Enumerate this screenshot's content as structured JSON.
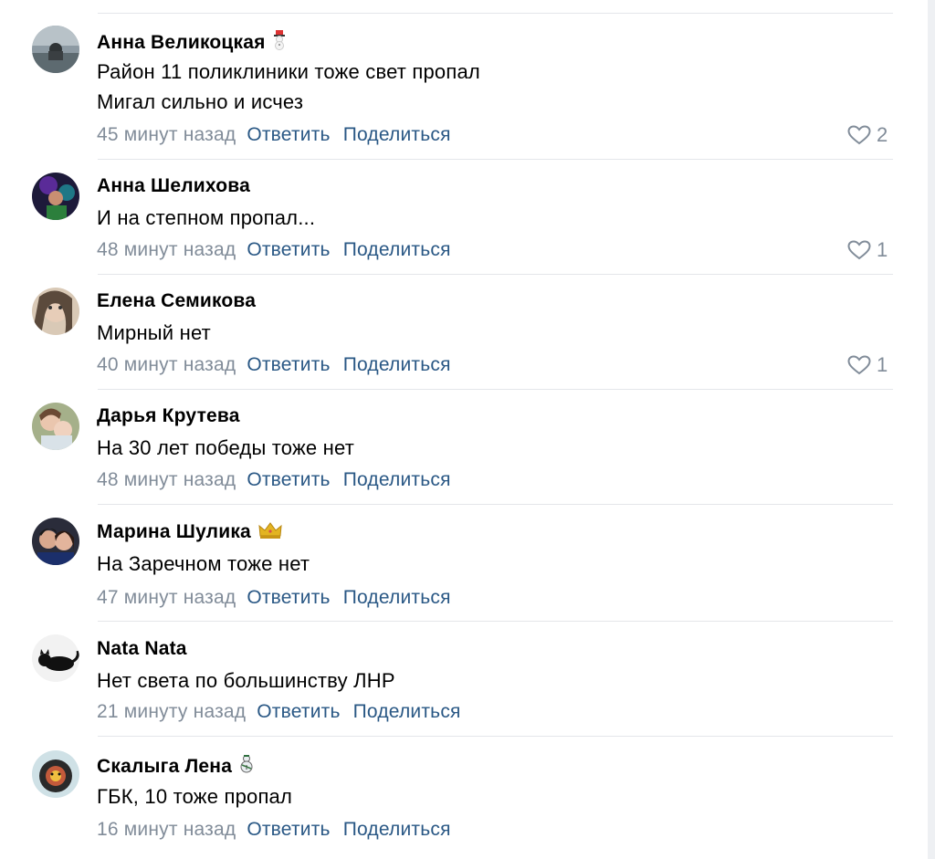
{
  "comments": [
    {
      "author": "Анна Великоцкая",
      "author_emoji": "snowman-icon",
      "lines": [
        "Район 11 поликлиники тоже свет пропал",
        "Мигал сильно и исчез"
      ],
      "time": "45 минут назад",
      "reply": "Ответить",
      "share": "Поделиться",
      "likes": "2"
    },
    {
      "author": "Анна Шелихова",
      "lines": [
        "И на степном пропал..."
      ],
      "time": "48 минут назад",
      "reply": "Ответить",
      "share": "Поделиться",
      "likes": "1"
    },
    {
      "author": "Елена Семикова",
      "lines": [
        "Мирный нет"
      ],
      "time": "40 минут назад",
      "reply": "Ответить",
      "share": "Поделиться",
      "likes": "1"
    },
    {
      "author": "Дарья Крутева",
      "lines": [
        "На 30 лет победы тоже нет"
      ],
      "time": "48 минут назад",
      "reply": "Ответить",
      "share": "Поделиться"
    },
    {
      "author": "Марина Шулика",
      "author_emoji": "crown-icon",
      "lines": [
        "На Заречном тоже нет"
      ],
      "time": "47 минут назад",
      "reply": "Ответить",
      "share": "Поделиться"
    },
    {
      "author": "Nata Nata",
      "lines": [
        "Нет света по большинству ЛНР"
      ],
      "time": "21 минуту назад",
      "reply": "Ответить",
      "share": "Поделиться"
    },
    {
      "author": "Скалыга Лена",
      "author_emoji": "snowman-icon",
      "lines": [
        "ГБК, 10 тоже пропал"
      ],
      "time": "16 минут назад",
      "reply": "Ответить",
      "share": "Поделиться"
    }
  ],
  "colors": {
    "link": "#2a5885",
    "muted": "#818c99",
    "divider": "#e4e6ea"
  }
}
